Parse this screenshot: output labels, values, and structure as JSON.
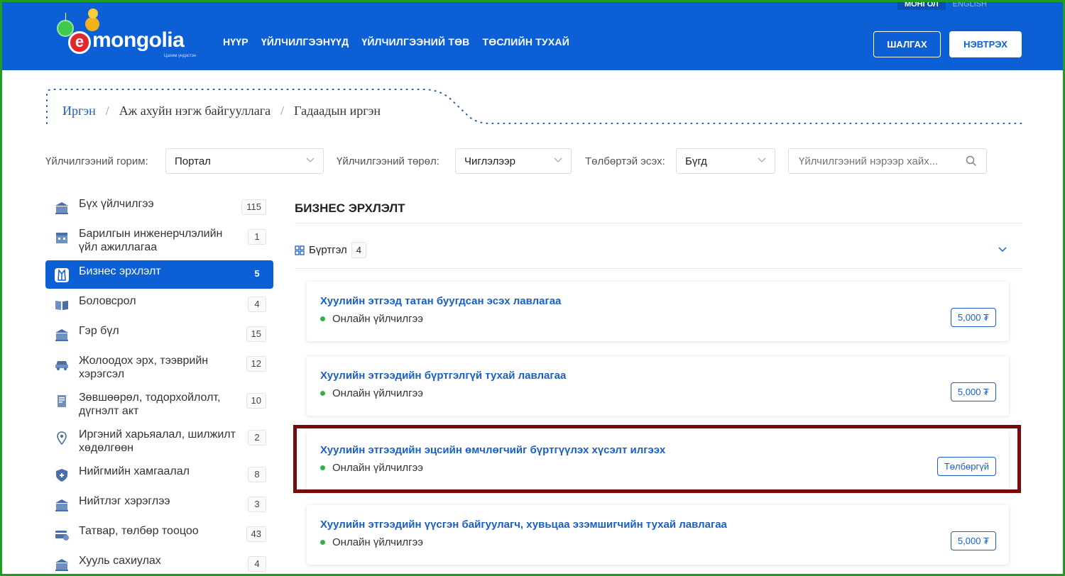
{
  "header": {
    "lang": [
      "МОНГОЛ",
      "ENGLISH"
    ],
    "logo_text": "mongolia",
    "logo_letter": "e",
    "logo_sub": "Цахим үндэстэн",
    "nav": [
      "НҮҮР",
      "ҮЙЛЧИЛГЭЭНҮҮД",
      "ҮЙЛЧИЛГЭЭНИЙ ТӨВ",
      "ТӨСЛИЙН ТУХАЙ"
    ],
    "search_button": "ШАЛГАХ",
    "login_button": "НЭВТРЭХ",
    "brand_color": "#0d5fd6"
  },
  "breadcrumb": {
    "items": [
      "Иргэн",
      "Аж ахуйн нэгж байгууллага",
      "Гадаадын иргэн"
    ],
    "separator": "/"
  },
  "filters": {
    "mode_label": "Үйлчилгээний горим:",
    "mode_value": "Портал",
    "type_label": "Үйлчилгээний төрөл:",
    "type_value": "Чиглэлээр",
    "paid_label": "Төлбөртэй эсэх:",
    "paid_value": "Бүгд",
    "search_placeholder": "Үйлчилгээний нэрээр хайх..."
  },
  "sidebar": {
    "items": [
      {
        "label": "Бүх үйлчилгээ",
        "count": "115",
        "icon": "building-icon",
        "active": false
      },
      {
        "label": "Барилгын инженерчлэлийн үйл ажиллагаа",
        "count": "1",
        "icon": "construction-icon",
        "active": false
      },
      {
        "label": "Бизнес эрхлэлт",
        "count": "5",
        "icon": "suit-icon",
        "active": true
      },
      {
        "label": "Боловсрол",
        "count": "4",
        "icon": "book-icon",
        "active": false
      },
      {
        "label": "Гэр бүл",
        "count": "15",
        "icon": "building-icon",
        "active": false
      },
      {
        "label": "Жолоодох эрх, тээврийн хэрэгсэл",
        "count": "12",
        "icon": "car-icon",
        "active": false
      },
      {
        "label": "Зөвшөөрөл, тодорхойлолт, дүгнэлт акт",
        "count": "10",
        "icon": "document-icon",
        "active": false
      },
      {
        "label": "Иргэний харьяалал, шилжилт хөдөлгөөн",
        "count": "2",
        "icon": "location-pin-icon",
        "active": false
      },
      {
        "label": "Нийгмийн хамгаалал",
        "count": "8",
        "icon": "shield-icon",
        "active": false
      },
      {
        "label": "Нийтлэг хэрэглээ",
        "count": "3",
        "icon": "building-icon",
        "active": false
      },
      {
        "label": "Татвар, төлбөр тооцоо",
        "count": "43",
        "icon": "card-icon",
        "active": false
      },
      {
        "label": "Хууль сахиулах",
        "count": "4",
        "icon": "building-icon",
        "active": false
      }
    ]
  },
  "main": {
    "section_title": "БИЗНЕС ЭРХЛЭЛТ",
    "group_label": "Бүртгэл",
    "group_count": "4",
    "cards": [
      {
        "title": "Хуулийн этгээд татан буугдсан эсэх лавлагаа",
        "status": "Онлайн үйлчилгээ",
        "price": "5,000 ₮"
      },
      {
        "title": "Хуулийн этгээдийн бүртгэлгүй тухай лавлагаа",
        "status": "Онлайн үйлчилгээ",
        "price": "5,000 ₮"
      },
      {
        "title": "Хуулийн этгээдийн эцсийн өмчлөгчийг бүртгүүлэх хүсэлт илгээх",
        "status": "Онлайн үйлчилгээ",
        "price": "Төлбөргүй"
      },
      {
        "title": "Хуулийн этгээдийн үүсгэн байгуулагч, хувьцаа эзэмшигчийн тухай лавлагаа",
        "status": "Онлайн үйлчилгээ",
        "price": "5,000 ₮"
      }
    ]
  }
}
